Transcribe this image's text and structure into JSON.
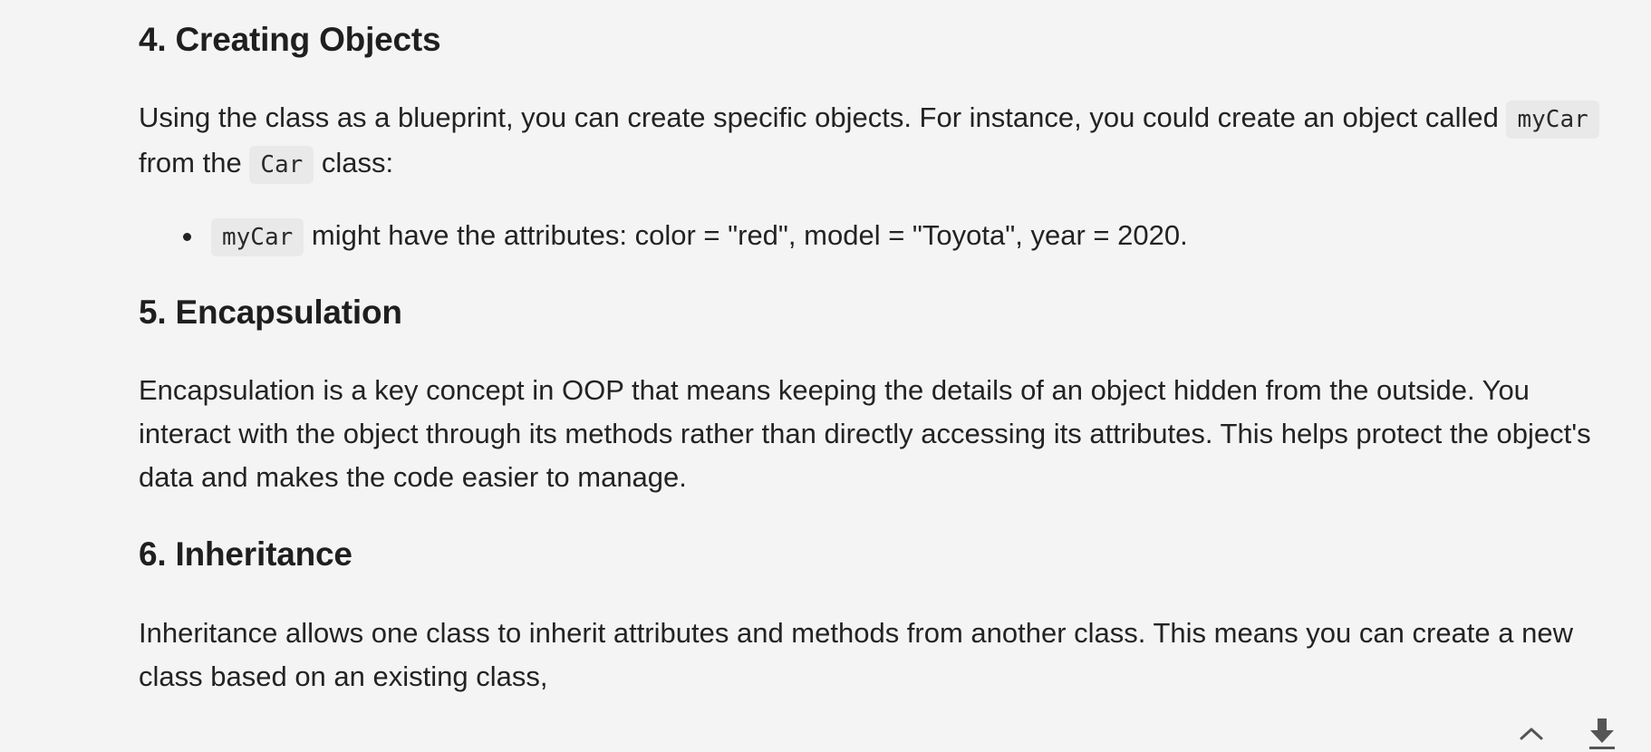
{
  "sections": [
    {
      "heading": "4. Creating Objects",
      "para": {
        "before": "Using the class as a blueprint, you can create specific objects. For instance, you could create an object called ",
        "code1": "myCar",
        "middle": " from the ",
        "code2": "Car",
        "after": " class:"
      },
      "bullet": {
        "code": "myCar",
        "text": " might have the attributes: color = \"red\", model = \"Toyota\", year = 2020."
      }
    },
    {
      "heading": "5. Encapsulation",
      "para": "Encapsulation is a key concept in OOP that means keeping the details of an object hidden from the outside. You interact with the object through its methods rather than directly accessing its attributes. This helps protect the object's data and makes the code easier to manage."
    },
    {
      "heading": "6. Inheritance",
      "para": "Inheritance allows one class to inherit attributes and methods from another class. This means you can create a new class based on an existing class,"
    }
  ],
  "controls": {
    "scroll_up_icon": "chevron-up-icon",
    "download_icon": "download-icon"
  }
}
